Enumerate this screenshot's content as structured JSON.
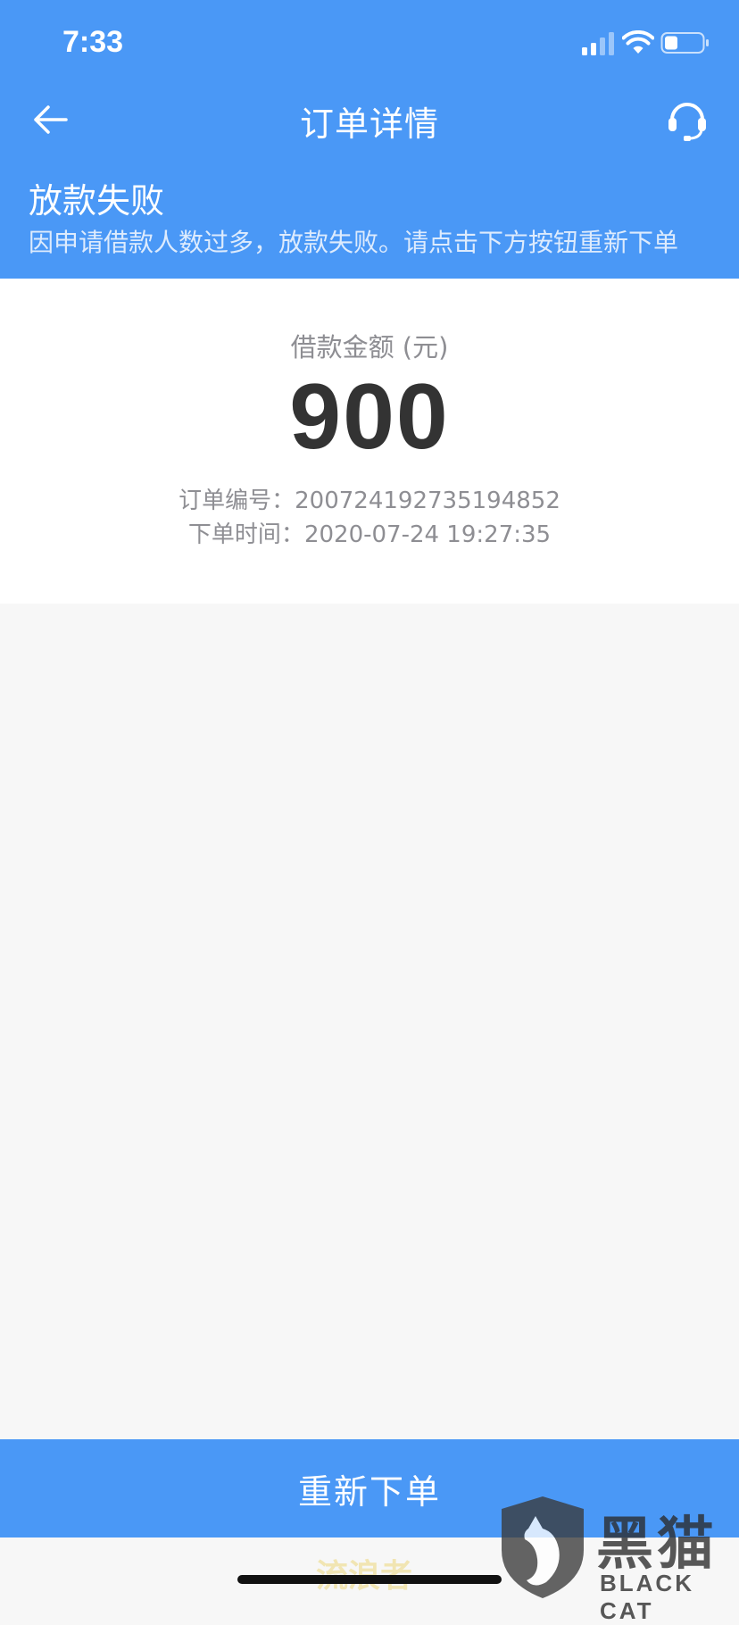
{
  "status_bar": {
    "time": "7:33",
    "icons": [
      "signal-icon",
      "wifi-icon",
      "battery-icon"
    ]
  },
  "nav": {
    "back_icon": "arrow-left-icon",
    "title": "订单详情",
    "support_icon": "headset-icon"
  },
  "status": {
    "title": "放款失败",
    "description": "因申请借款人数过多，放款失败。请点击下方按钮重新下单"
  },
  "amount": {
    "label": "借款金额 (元)",
    "value": "900"
  },
  "order": {
    "number_label": "订单编号：",
    "number": "200724192735194852",
    "time_label": "下单时间：",
    "time": "2020-07-24 19:27:35"
  },
  "action": {
    "reorder_label": "重新下单"
  },
  "watermark": {
    "text": "流浪者",
    "logo_cn": "黑猫",
    "logo_en": "BLACK CAT"
  },
  "colors": {
    "primary": "#4a98f6",
    "background": "#f7f7f7",
    "card": "#ffffff",
    "amount_text": "#333333",
    "secondary_text": "#8e8e93"
  }
}
